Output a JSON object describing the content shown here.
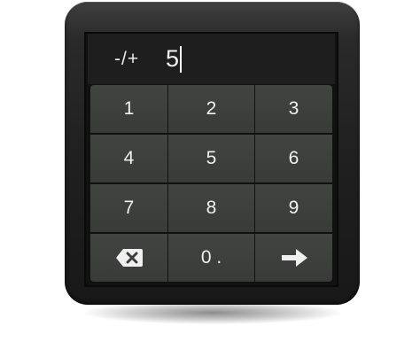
{
  "display": {
    "sign_toggle_label": "-/+",
    "value": "5"
  },
  "keypad": {
    "rows": [
      [
        "1",
        "2",
        "3"
      ],
      [
        "4",
        "5",
        "6"
      ],
      [
        "7",
        "8",
        "9"
      ]
    ],
    "decimal_key_label": "0 .",
    "backspace_icon": "backspace-icon",
    "enter_icon": "arrow-right-icon"
  }
}
